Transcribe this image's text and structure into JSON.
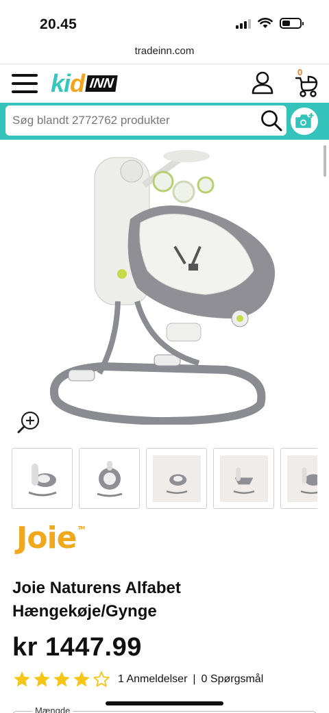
{
  "status": {
    "time": "20.45"
  },
  "browser": {
    "url": "tradeinn.com"
  },
  "header": {
    "logo_kid": "kid",
    "logo_inn": "INN",
    "cart_count": "0",
    "icons": [
      "menu-icon",
      "user-icon",
      "stroller-cart-icon"
    ]
  },
  "search": {
    "placeholder": "Søg blandt 2772762 produkter",
    "icons": [
      "search-icon",
      "camera-plus-icon"
    ]
  },
  "gallery": {
    "thumbnail_count": 5,
    "icons": [
      "zoom-in-icon"
    ]
  },
  "product": {
    "brand": "Joie",
    "brand_tm": "TM",
    "title": "Joie Naturens Alfabet Hængekøje/Gynge",
    "price": "kr 1447.99",
    "rating": 4,
    "rating_max": 5,
    "reviews_label": "1 Anmeldelser",
    "separator": "|",
    "questions_label": "0 Spørgsmål",
    "quantity_label": "Mængde"
  },
  "colors": {
    "accent": "#34c3ba",
    "brand_orange": "#f0a81c",
    "star": "#f5c518",
    "cart_badge": "#f07c1d"
  }
}
